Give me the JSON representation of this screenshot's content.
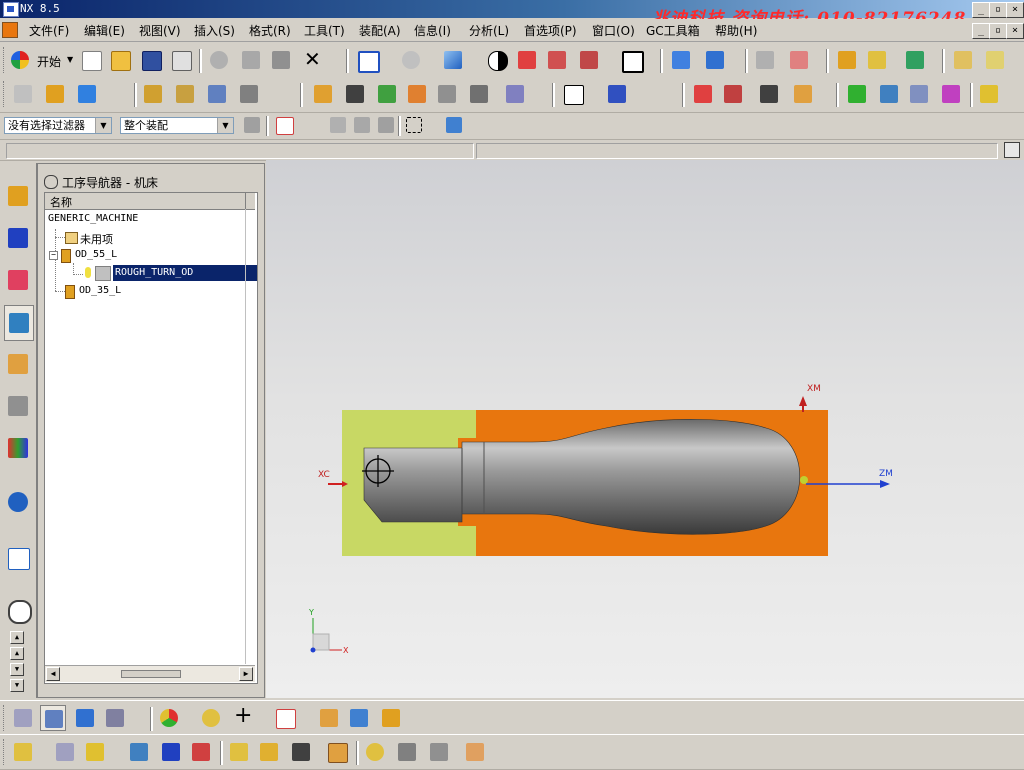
{
  "window": {
    "title": "NX 8.5",
    "minimize_glyph": "_",
    "restore_glyph": "▫",
    "close_glyph": "×",
    "doc_minimize_glyph": "_",
    "doc_restore_glyph": "▫",
    "doc_close_glyph": "×"
  },
  "watermark": "兆迪科技 咨询电话: 010-82176248",
  "menu": [
    "文件(F)",
    "编辑(E)",
    "视图(V)",
    "插入(S)",
    "格式(R)",
    "工具(T)",
    "装配(A)",
    "信息(I)",
    "分析(L)",
    "首选项(P)",
    "窗口(O)",
    "GC工具箱",
    "帮助(H)"
  ],
  "toolbar1": {
    "start_label": "开始"
  },
  "selection_bar": {
    "filter_value": "没有选择过滤器",
    "scope_value": "整个装配"
  },
  "navigator": {
    "title": "工序导航器 - 机床",
    "column_header": "名称",
    "items": [
      {
        "label": "GENERIC_MACHINE"
      },
      {
        "label": "未用项"
      },
      {
        "label": "OD_55_L"
      },
      {
        "label": "ROUGH_TURN_OD",
        "selected": true
      },
      {
        "label": "OD_35_L"
      }
    ]
  },
  "csys": {
    "xm": "XM",
    "xc": "XC",
    "zm": "ZM",
    "triad_y": "Y",
    "triad_x": "X"
  },
  "colors": {
    "accent_blue": "#0a246a",
    "watermark_red": "#ff2a2a",
    "blank_orange": "#e8760e",
    "chuck_green": "#c8d864",
    "part_gray": "#8a8a8a",
    "selection_blue": "#0a246a"
  }
}
